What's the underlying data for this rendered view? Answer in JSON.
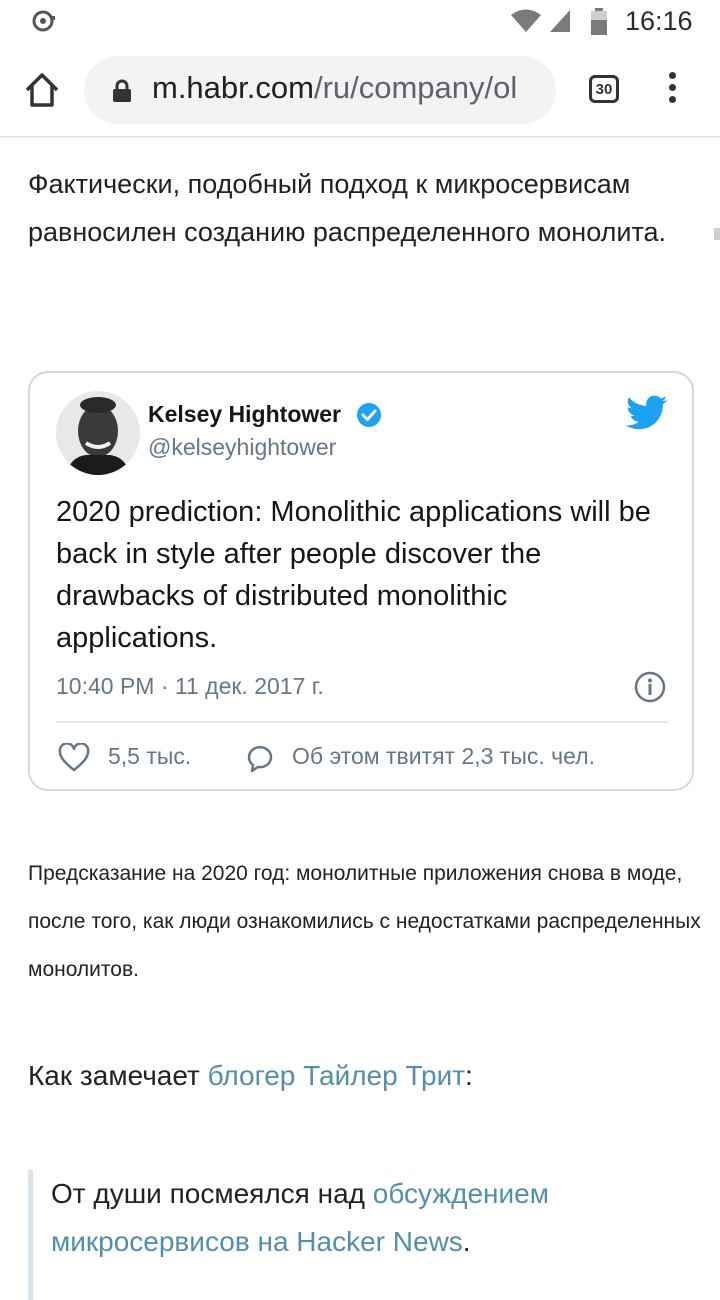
{
  "status_bar": {
    "time": "16:16",
    "icons": [
      "notification-icon",
      "wifi-icon",
      "signal-icon",
      "battery-icon"
    ]
  },
  "browser": {
    "url_host": "m.habr.com",
    "url_path": "/ru/company/ol",
    "tab_count": "30",
    "icons": [
      "home-icon",
      "lock-icon",
      "tabs-icon",
      "menu-icon"
    ]
  },
  "article": {
    "paragraph1": "Фактически, подобный подход к микросервисам равносилен созданию распределенного монолита.",
    "paragraph2": "Предсказание на 2020 год: монолитные приложения снова в моде, после того, как люди ознакомились с недостатками распределенных монолитов.",
    "paragraph3": {
      "before": "Как замечает ",
      "link": "блогер Тайлер Трит",
      "after": ":"
    },
    "quote": {
      "before": "От души посмеялся над ",
      "link": "обсуждением микросервисов на Hacker News",
      "after": "."
    }
  },
  "tweet": {
    "author_name": "Kelsey Hightower",
    "author_handle": "@kelseyhightower",
    "text": "2020 prediction: Monolithic applications will be back in style after people discover the drawbacks of distributed monolithic applications.",
    "timestamp": "10:40 PM · 11 дек. 2017 г.",
    "likes": "5,5 тыс.",
    "retweets": "Об этом твитят 2,3 тыс. чел."
  },
  "colors": {
    "link": "#548eaa",
    "twitter_blue": "#1da1f2",
    "tweet_border": "#cfd9de",
    "muted_text": "#657786"
  }
}
